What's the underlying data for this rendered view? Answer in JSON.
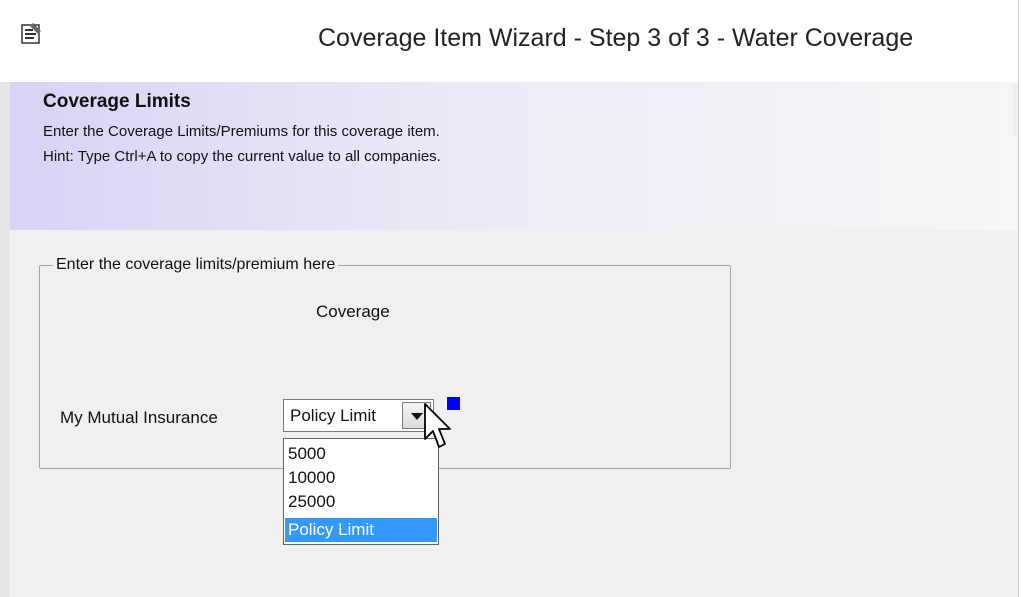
{
  "window": {
    "title": "Coverage Item Wizard - Step 3 of 3 - Water Coverage",
    "icon": "wizard-app-icon"
  },
  "header": {
    "title": "Coverage Limits",
    "description": "Enter the Coverage Limits/Premiums for this coverage item.",
    "hint": "Hint: Type Ctrl+A to copy the current value to all companies."
  },
  "group": {
    "legend": "Enter the coverage limits/premium here",
    "column_header": "Coverage",
    "rows": [
      {
        "company": "My Mutual Insurance",
        "selected_value": "Policy Limit",
        "indicator_color": "#0000ff",
        "options": [
          "5000",
          "10000",
          "25000",
          "Policy Limit"
        ],
        "highlighted_option": "Policy Limit"
      }
    ]
  },
  "colors": {
    "header_gradient_start": "#d8d2f4",
    "selection_highlight": "#3399ff",
    "indicator_blue": "#0000ff",
    "indicator_green": "#009900"
  }
}
